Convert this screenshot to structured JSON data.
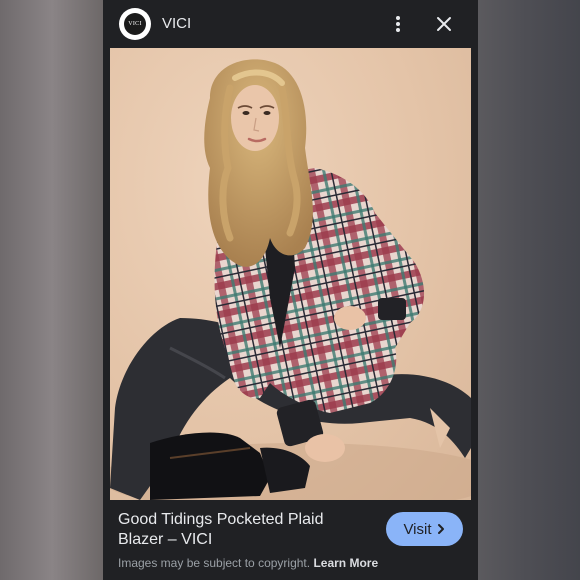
{
  "header": {
    "logo_text": "VICI",
    "source_name": "VICI",
    "menu_icon": "more-vert-icon",
    "close_icon": "close-icon"
  },
  "image": {
    "description_icon": "product-photo"
  },
  "footer": {
    "title_line1": "Good Tidings Pocketed Plaid",
    "title_line2": "Blazer – VICI",
    "visit_label": "Visit",
    "visit_icon": "chevron-right-icon",
    "copyright_text": "Images may be subject to copyright.",
    "learn_more_label": "Learn More"
  },
  "colors": {
    "panel_bg": "#202124",
    "visit_button": "#8ab4f8",
    "text_primary": "#e8eaed",
    "text_secondary": "#9aa0a6"
  }
}
